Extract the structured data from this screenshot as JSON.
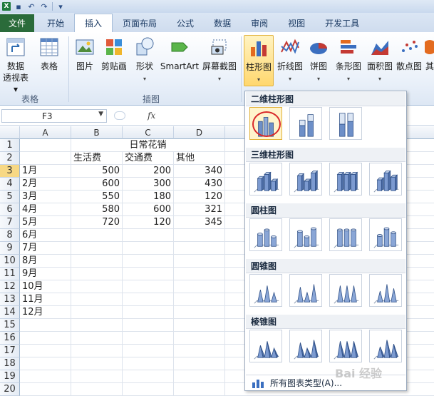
{
  "ribbon_tabs": [
    "文件",
    "开始",
    "插入",
    "页面布局",
    "公式",
    "数据",
    "审阅",
    "视图",
    "开发工具"
  ],
  "active_tab": "插入",
  "ribbon_buttons": {
    "pivot": "数据\n透视表",
    "table": "表格",
    "picture": "图片",
    "clipart": "剪贴画",
    "shapes": "形状",
    "smartart": "SmartArt",
    "screenshot": "屏幕截图",
    "column": "柱形图",
    "line": "折线图",
    "pie": "饼图",
    "bar": "条形图",
    "area": "面积图",
    "scatter": "散点图",
    "other": "其"
  },
  "group_labels": {
    "tables": "表格",
    "illustrations": "插图"
  },
  "name_box": "F3",
  "formula_label": "fx",
  "columns": [
    "A",
    "B",
    "C",
    "D"
  ],
  "rows": [
    "1",
    "2",
    "3",
    "4",
    "5",
    "6",
    "7",
    "8",
    "9",
    "10",
    "11",
    "12",
    "13",
    "14",
    "15",
    "16",
    "17",
    "18",
    "19",
    "20"
  ],
  "sheet": {
    "title": "日常花销",
    "headers": [
      "生活费",
      "交通费",
      "其他"
    ],
    "data": [
      [
        "1月",
        "500",
        "200",
        "340"
      ],
      [
        "2月",
        "600",
        "300",
        "430"
      ],
      [
        "3月",
        "550",
        "180",
        "120"
      ],
      [
        "4月",
        "580",
        "600",
        "321"
      ],
      [
        "5月",
        "720",
        "120",
        "345"
      ],
      [
        "6月",
        "",
        "",
        ""
      ],
      [
        "7月",
        "",
        "",
        ""
      ],
      [
        "8月",
        "",
        "",
        ""
      ],
      [
        "9月",
        "",
        "",
        ""
      ],
      [
        "10月",
        "",
        "",
        ""
      ],
      [
        "11月",
        "",
        "",
        ""
      ],
      [
        "12月",
        "",
        "",
        ""
      ]
    ]
  },
  "dropdown": {
    "sections": [
      "二维柱形图",
      "三维柱形图",
      "圆柱图",
      "圆锥图",
      "棱锥图"
    ],
    "all_types": "所有图表类型(A)..."
  },
  "colors": {
    "file_tab": "#2a6b3a",
    "accent": "#1f7a3e",
    "highlight": "#ffd76e",
    "ring": "#d9282a"
  },
  "watermark": "Bai 经验"
}
